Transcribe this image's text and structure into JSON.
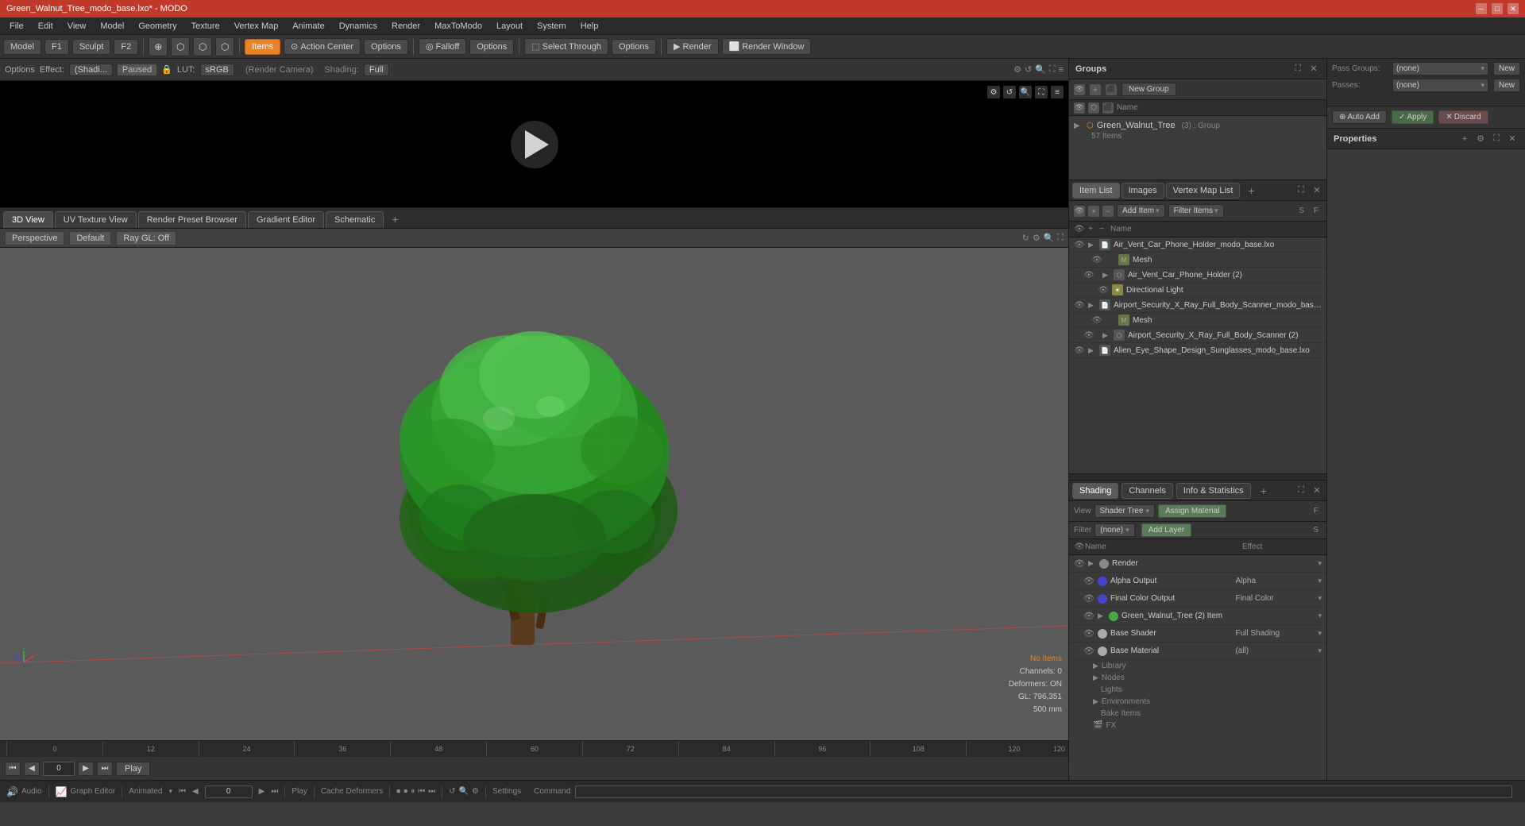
{
  "app": {
    "title": "Green_Walnut_Tree_modo_base.lxo* - MODO",
    "version": "MODO"
  },
  "titlebar": {
    "title": "Green_Walnut_Tree_modo_base.lxo* - MODO",
    "minimize": "─",
    "maximize": "□",
    "close": "✕"
  },
  "menubar": {
    "items": [
      "File",
      "Edit",
      "View",
      "Model",
      "Geometry",
      "Texture",
      "Vertex Map",
      "Animate",
      "Dynamics",
      "Render",
      "MaxToModo",
      "Layout",
      "System",
      "Help"
    ]
  },
  "toolbar": {
    "model_btn": "Model",
    "f1_btn": "F1",
    "sculpt_btn": "Sculpt",
    "f2_btn": "F2",
    "auto_select": "Auto Select",
    "items_btn": "Items",
    "action_center_btn": "Action Center",
    "options_btn": "Options",
    "falloff_btn": "Falloff",
    "options2_btn": "Options",
    "select_through_btn": "Select Through",
    "options3_btn": "Options",
    "render_btn": "Render",
    "render_window_btn": "Render Window"
  },
  "options_bar": {
    "label": "Options",
    "effect_label": "Effect:",
    "effect_value": "(Shadi...",
    "paused": "Paused",
    "lut_label": "LUT:",
    "lut_value": "sRGB",
    "camera_label": "(Render Camera)",
    "shading_label": "Shading:",
    "shading_value": "Full"
  },
  "viewport_tabs": {
    "tabs": [
      "3D View",
      "UV Texture View",
      "Render Preset Browser",
      "Gradient Editor",
      "Schematic"
    ],
    "add": "+"
  },
  "viewport_subtoolbar": {
    "perspective": "Perspective",
    "default": "Default",
    "ray_gl": "Ray GL: Off"
  },
  "viewport_3d": {
    "no_items": "No Items",
    "channels": "Channels: 0",
    "deformers": "Deformers: ON",
    "gl_coords": "GL: 796,351",
    "size": "500 mm"
  },
  "timeline": {
    "markers": [
      "0",
      "12",
      "24",
      "36",
      "48",
      "60",
      "72",
      "84",
      "96",
      "108",
      "120"
    ],
    "end_label": "120",
    "frame_value": "0",
    "play_btn": "Play",
    "cache_label": "Cache Deformers",
    "settings_label": "Settings"
  },
  "status_bar": {
    "audio": "Audio",
    "graph_editor": "Graph Editor",
    "animated": "Animated",
    "play": "Play",
    "command_label": "Command"
  },
  "groups_panel": {
    "title": "Groups",
    "new_group_btn": "New Group",
    "col_name": "Name",
    "tree": {
      "item_name": "Green_Walnut_Tree",
      "item_count": "(3) : Group",
      "item_sub": "57 Items"
    }
  },
  "itemlist_panel": {
    "tabs": [
      "Item List",
      "Images",
      "Vertex Map List"
    ],
    "add_item_btn": "Add Item",
    "filter_btn": "Filter Items",
    "col_name": "Name",
    "items": [
      {
        "name": "Air_Vent_Car_Phone_Holder_modo_base.lxo",
        "indent": 0,
        "has_arrow": true,
        "type": "file"
      },
      {
        "name": "Mesh",
        "indent": 1,
        "has_arrow": false,
        "type": "mesh"
      },
      {
        "name": "Air_Vent_Car_Phone_Holder (2)",
        "indent": 1,
        "has_arrow": true,
        "type": "group"
      },
      {
        "name": "Directional Light",
        "indent": 2,
        "has_arrow": false,
        "type": "light"
      },
      {
        "name": "Airport_Security_X_Ray_Full_Body_Scanner_modo_base.l ...",
        "indent": 0,
        "has_arrow": true,
        "type": "file"
      },
      {
        "name": "Mesh",
        "indent": 1,
        "has_arrow": false,
        "type": "mesh"
      },
      {
        "name": "Airport_Security_X_Ray_Full_Body_Scanner (2)",
        "indent": 1,
        "has_arrow": true,
        "type": "group"
      },
      {
        "name": "Alien_Eye_Shape_Design_Sunglasses_modo_base.lxo",
        "indent": 0,
        "has_arrow": true,
        "type": "file"
      }
    ]
  },
  "shading_panel": {
    "tabs": [
      "Shading",
      "Channels",
      "Info & Statistics"
    ],
    "add_tab": "+",
    "view_label": "View",
    "view_value": "Shader Tree",
    "assign_material_btn": "Assign Material",
    "f_key": "F",
    "filter_label": "Filter",
    "filter_value": "(none)",
    "add_layer_btn": "Add Layer",
    "s_key": "S",
    "col_name": "Name",
    "col_effect": "Effect",
    "items": [
      {
        "name": "Render",
        "indent": 0,
        "has_arrow": true,
        "icon_color": "#888",
        "effect": "",
        "type": "render"
      },
      {
        "name": "Alpha Output",
        "indent": 1,
        "has_arrow": false,
        "icon_color": "#4444cc",
        "effect": "Alpha",
        "type": "output"
      },
      {
        "name": "Final Color Output",
        "indent": 1,
        "has_arrow": false,
        "icon_color": "#4444cc",
        "effect": "Final Color",
        "type": "output"
      },
      {
        "name": "Green_Walnut_Tree (2) Item",
        "indent": 1,
        "has_arrow": true,
        "icon_color": "#44aa44",
        "effect": "",
        "type": "item"
      },
      {
        "name": "Base Shader",
        "indent": 1,
        "has_arrow": false,
        "icon_color": "#aaaaaa",
        "effect": "Full Shading",
        "type": "shader"
      },
      {
        "name": "Base Material",
        "indent": 1,
        "has_arrow": false,
        "icon_color": "#aaaaaa",
        "effect": "(all)",
        "type": "material"
      }
    ],
    "sub_items": [
      "Library",
      "Nodes",
      "Lights",
      "Environments",
      "Bake Items",
      "FX"
    ],
    "sub_arrows": [
      true,
      true,
      false,
      true,
      false,
      true
    ]
  },
  "props_panel": {
    "title": "Properties",
    "pass_groups_label": "Pass Groups:",
    "passes_label": "Passes:",
    "pass_groups_value": "(none)",
    "passes_value": "(none)",
    "new_btn": "New",
    "new_btn2": "New",
    "auto_add_btn": "Auto Add",
    "apply_btn": "Apply",
    "discard_btn": "Discard"
  }
}
